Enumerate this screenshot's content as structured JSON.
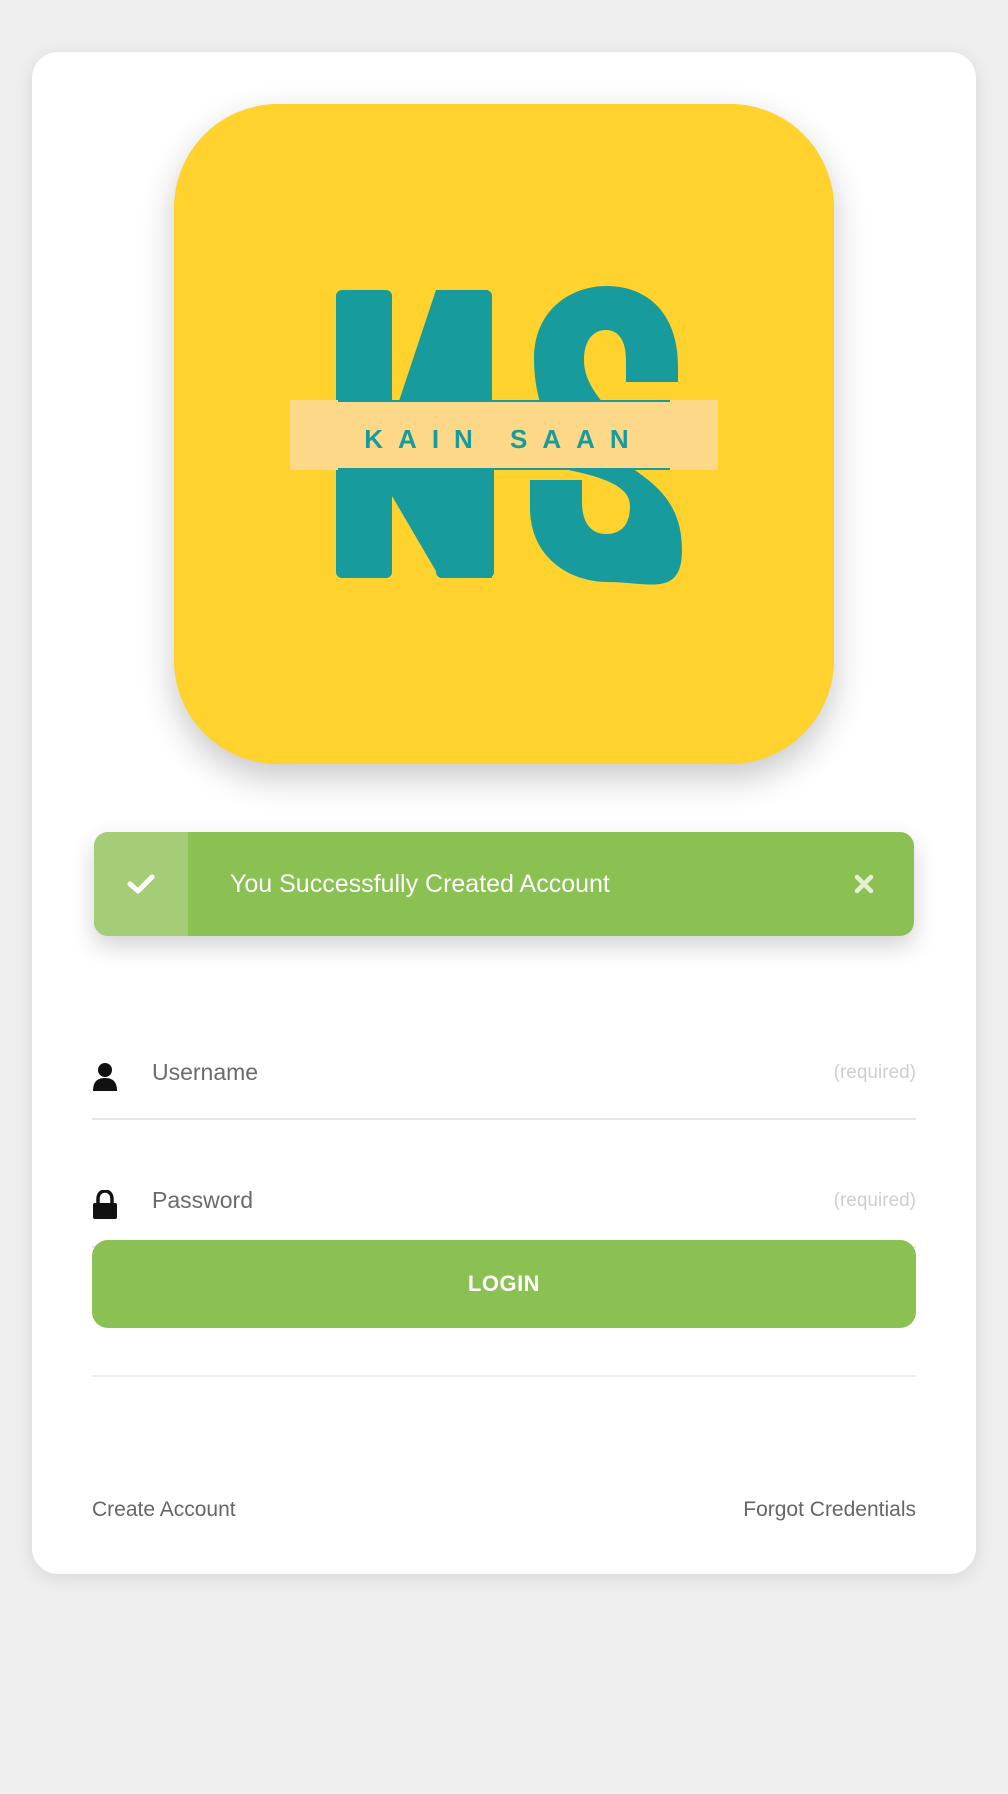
{
  "logo": {
    "monogram": "KS",
    "brand_name": "KAIN SAAN",
    "icon": "ks-monogram-logo"
  },
  "alert": {
    "message": "You Successfully Created Account",
    "status_icon": "check-icon",
    "close_icon": "close-icon"
  },
  "form": {
    "username": {
      "placeholder": "Username",
      "value": "",
      "hint": "(required)",
      "icon": "user-icon"
    },
    "password": {
      "placeholder": "Password",
      "value": "",
      "hint": "(required)",
      "icon": "lock-icon"
    },
    "login_label": "LOGIN"
  },
  "links": {
    "create_account": "Create Account",
    "forgot_credentials": "Forgot Credentials"
  },
  "colors": {
    "background": "#efefef",
    "card": "#ffffff",
    "logo_tile": "#ffd22d",
    "logo_teal": "#189b9c",
    "logo_band": "#fdd888",
    "success_green": "#8bc152",
    "success_green_light": "#a5cd77"
  }
}
